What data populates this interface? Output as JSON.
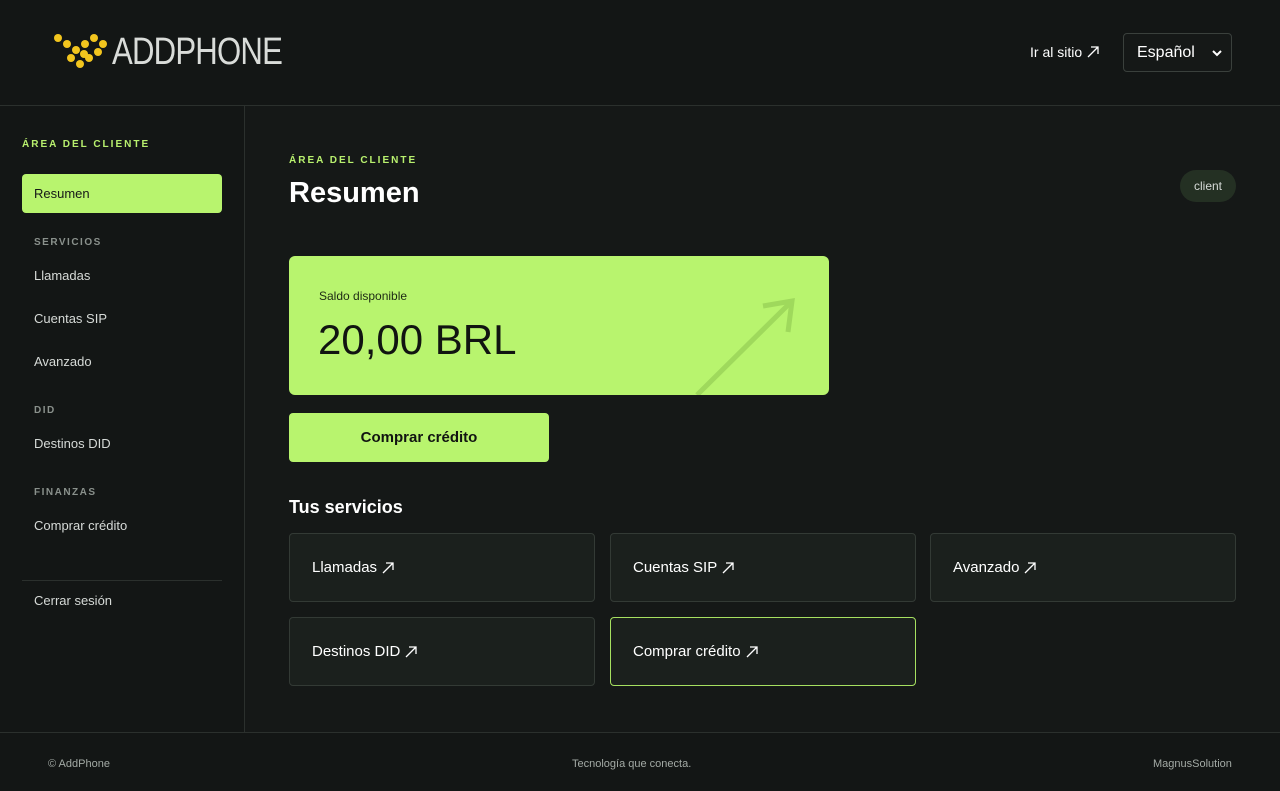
{
  "header": {
    "brand": "ADDPHONE",
    "goto_site": "Ir al sitio",
    "language": "Español"
  },
  "sidebar": {
    "heading": "ÁREA DEL CLIENTE",
    "active_item": "Resumen",
    "sections": [
      {
        "title": "SERVICIOS",
        "items": [
          "Llamadas",
          "Cuentas SIP",
          "Avanzado"
        ]
      },
      {
        "title": "DID",
        "items": [
          "Destinos DID"
        ]
      },
      {
        "title": "FINANZAS",
        "items": [
          "Comprar crédito"
        ]
      }
    ],
    "logout": "Cerrar sesión"
  },
  "main": {
    "kicker": "ÁREA DEL CLIENTE",
    "title": "Resumen",
    "role_badge": "client",
    "balance": {
      "label": "Saldo disponible",
      "amount": "20,00 BRL"
    },
    "buy_button": "Comprar crédito",
    "services_title": "Tus servicios",
    "services": [
      "Llamadas",
      "Cuentas SIP",
      "Avanzado",
      "Destinos DID",
      "Comprar crédito"
    ]
  },
  "footer": {
    "copyright": "© AddPhone",
    "tagline": "Tecnología que conecta.",
    "vendor": "MagnusSolution"
  },
  "colors": {
    "accent": "#b8f46e",
    "background": "#151817",
    "card": "#1b201d"
  }
}
